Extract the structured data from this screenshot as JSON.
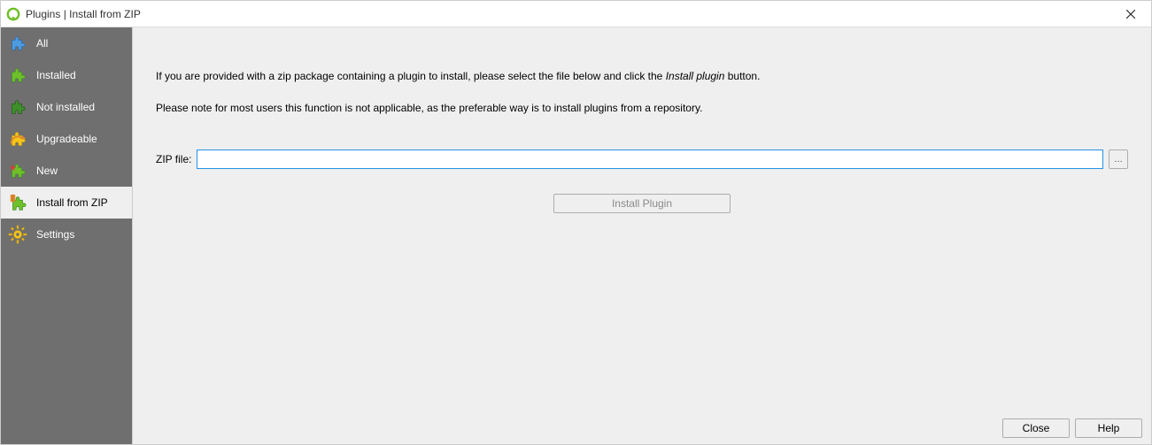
{
  "window": {
    "title": "Plugins | Install from ZIP"
  },
  "sidebar": {
    "items": [
      {
        "label": "All"
      },
      {
        "label": "Installed"
      },
      {
        "label": "Not installed"
      },
      {
        "label": "Upgradeable"
      },
      {
        "label": "New"
      },
      {
        "label": "Install from ZIP"
      },
      {
        "label": "Settings"
      }
    ]
  },
  "main": {
    "paragraph1_pre": "If you are provided with a zip package containing a plugin to install, please select the file below and click the ",
    "paragraph1_italic": "Install plugin",
    "paragraph1_post": " button.",
    "paragraph2": "Please note for most users this function is not applicable, as the preferable way is to install plugins from a repository.",
    "zip_label": "ZIP file:",
    "zip_value": "",
    "browse_label": "…",
    "install_label": "Install Plugin"
  },
  "footer": {
    "close_label": "Close",
    "help_label": "Help"
  },
  "colors": {
    "puzzle_blue": "#4e9ae0",
    "puzzle_green": "#6fbf2a",
    "puzzle_dark_green": "#3f8f2a",
    "accent_yellow": "#f5c518",
    "accent_orange": "#e08a2e"
  }
}
